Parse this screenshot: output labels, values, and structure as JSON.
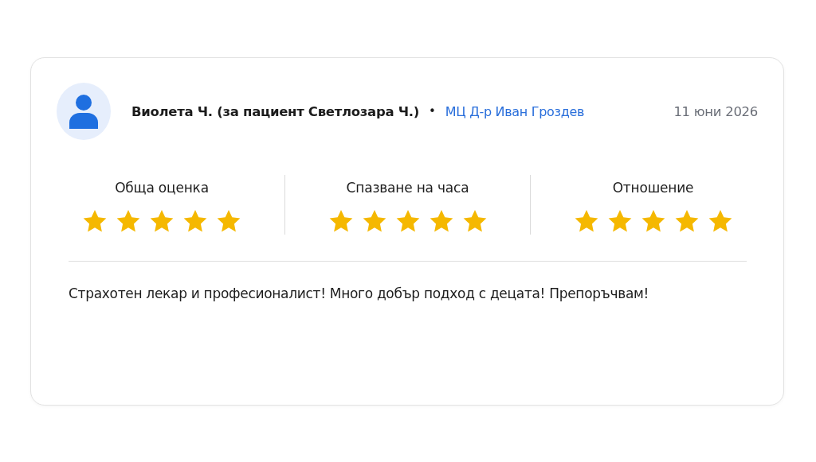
{
  "review": {
    "author": "Виолета Ч. (за пациент Светлозара Ч.)",
    "separator": "•",
    "clinic": "МЦ Д-р Иван Гроздев",
    "date": "11 юни 2026",
    "ratings": [
      {
        "label": "Обща оценка",
        "stars": 5
      },
      {
        "label": "Спазване на часа",
        "stars": 5
      },
      {
        "label": "Отношение",
        "stars": 5
      }
    ],
    "text": "Страхотен лекар и професионалист! Много добър подход с децата! Препоръчвам!"
  }
}
